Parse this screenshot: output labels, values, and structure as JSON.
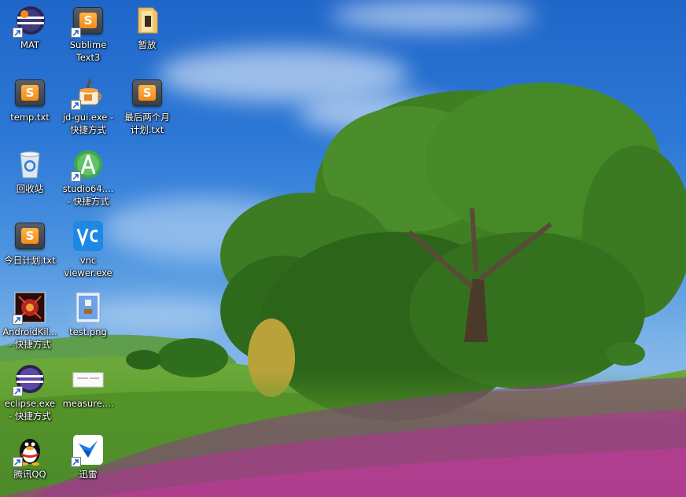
{
  "desktop": {
    "icons": [
      {
        "label": "MAT",
        "icon": "eclipse-mat-icon",
        "shortcut": true
      },
      {
        "label": "Sublime\nText3",
        "icon": "sublime-text-icon",
        "shortcut": true
      },
      {
        "label": "暂放",
        "icon": "folder-icon",
        "shortcut": false
      },
      {
        "label": "temp.txt",
        "icon": "sublime-text-icon",
        "shortcut": false
      },
      {
        "label": "jd-gui.exe -\n快捷方式",
        "icon": "java-cup-icon",
        "shortcut": true
      },
      {
        "label": "最后两个月\n计划.txt",
        "icon": "sublime-text-icon",
        "shortcut": false
      },
      {
        "label": "回收站",
        "icon": "recycle-bin-icon",
        "shortcut": false
      },
      {
        "label": "studio64....\n- 快捷方式",
        "icon": "android-studio-icon",
        "shortcut": true
      },
      {
        "label": "今日计划.txt",
        "icon": "sublime-text-icon",
        "shortcut": false
      },
      {
        "label": "vnc\nviewer.exe",
        "icon": "vnc-viewer-icon",
        "shortcut": false
      },
      {
        "label": "AndroidKil...\n- 快捷方式",
        "icon": "androidkiller-icon",
        "shortcut": true
      },
      {
        "label": "test.png",
        "icon": "image-file-icon",
        "shortcut": false
      },
      {
        "label": "eclipse.exe\n- 快捷方式",
        "icon": "eclipse-icon",
        "shortcut": true
      },
      {
        "label": "measure....",
        "icon": "image-thumbnail-icon",
        "shortcut": false
      },
      {
        "label": "腾讯QQ",
        "icon": "qq-penguin-icon",
        "shortcut": true
      },
      {
        "label": "迅雷",
        "icon": "thunder-icon",
        "shortcut": true
      }
    ]
  },
  "colors": {
    "sky_top": "#1f66c9",
    "sky_bottom": "#a9cdef",
    "grass": "#4c8a2a",
    "tree": "#2f6a1c",
    "flowers": "#c2389a",
    "label_text": "#ffffff"
  }
}
